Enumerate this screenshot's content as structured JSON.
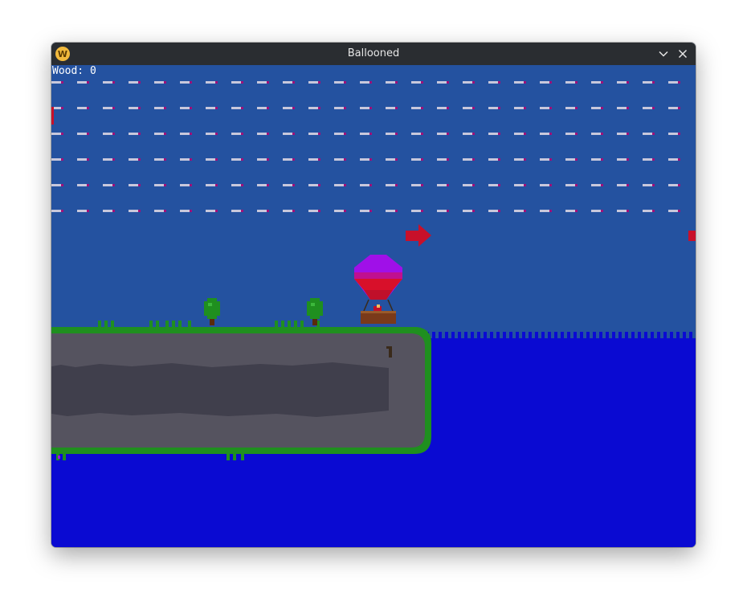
{
  "window": {
    "title": "Ballooned",
    "app_icon_letter": "W",
    "minimize_icon": "chevron-down-icon",
    "close_icon": "close-icon"
  },
  "hud": {
    "wood_label": "Wood: 0"
  },
  "colors": {
    "sky": "#2452a0",
    "sea": "#0a0ad2",
    "rock_light": "#55535f",
    "rock_dark": "#403f4c",
    "grass": "#1f8f1f",
    "wind_dash": "#c8c8dc",
    "wind_arrow": "#c8102a",
    "balloon_top": "#a010e8",
    "balloon_bottom": "#d8102a",
    "basket": "#7a3a1a",
    "titlebar": "#2a2d31"
  }
}
